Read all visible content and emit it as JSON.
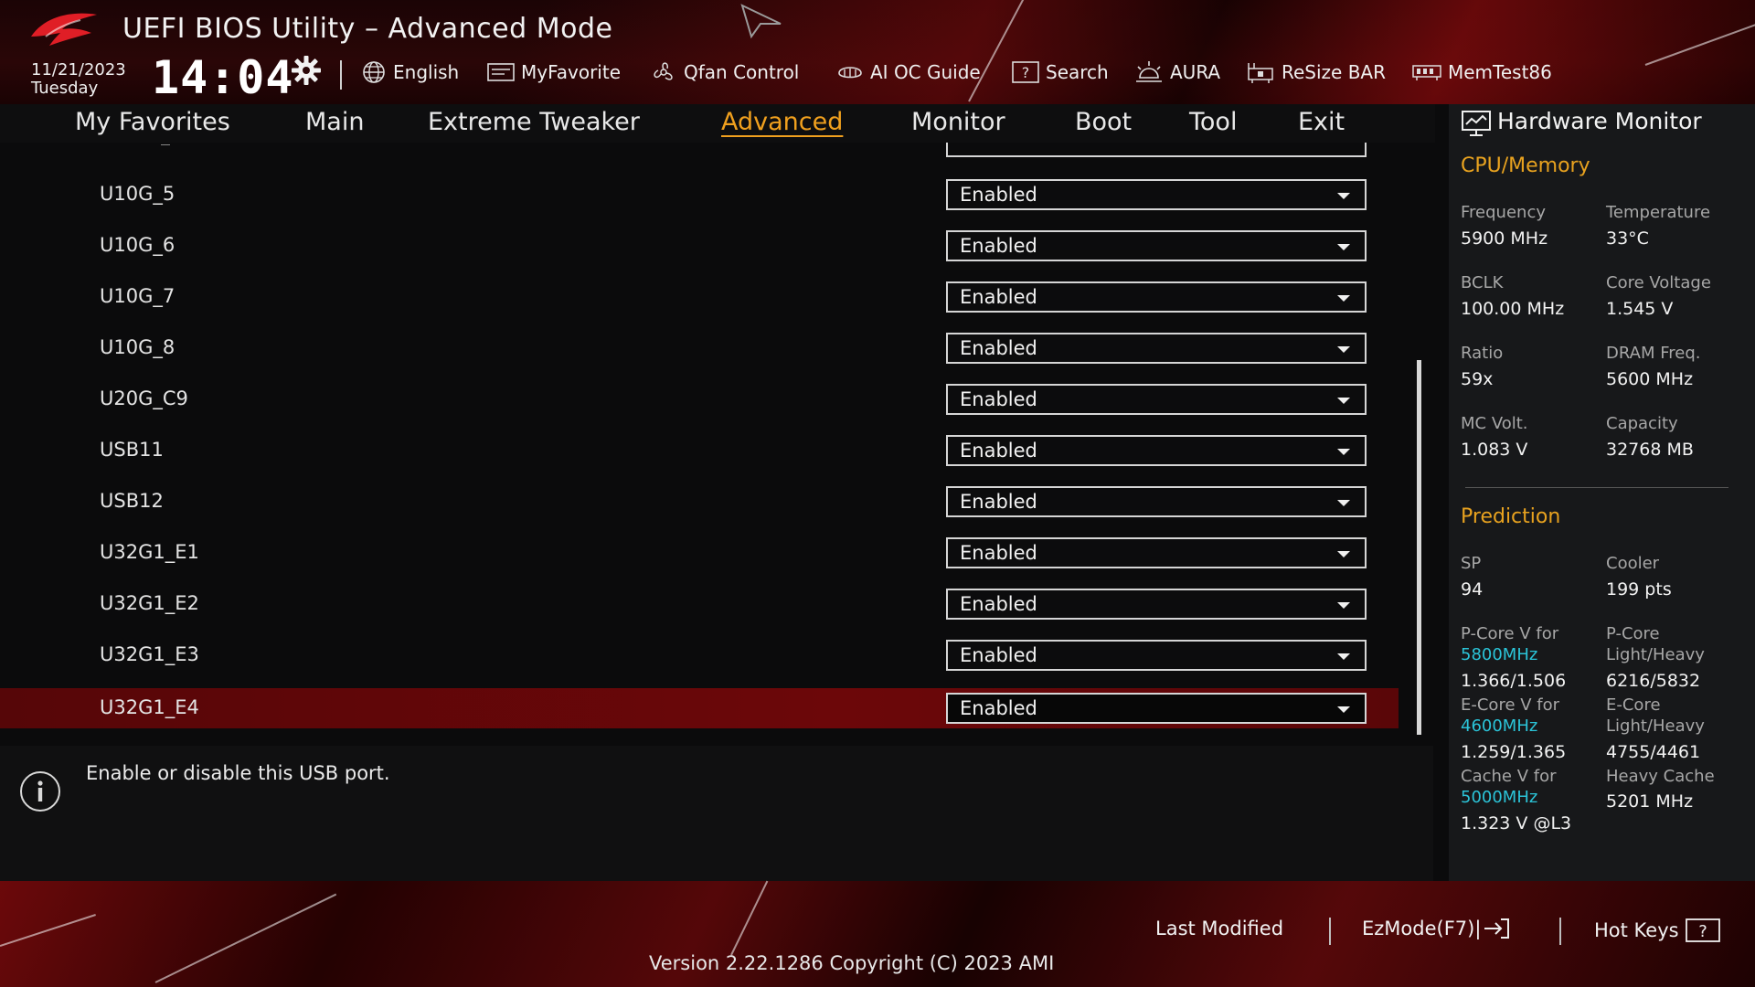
{
  "header": {
    "title": "UEFI BIOS Utility – Advanced Mode",
    "date": "11/21/2023",
    "day": "Tuesday",
    "time": "14:04",
    "tools": [
      {
        "label": "English",
        "icon": "globe-icon"
      },
      {
        "label": "MyFavorite",
        "icon": "favorite-icon"
      },
      {
        "label": "Qfan Control",
        "icon": "fan-icon"
      },
      {
        "label": "AI OC Guide",
        "icon": "ai-oc-icon"
      },
      {
        "label": "Search",
        "icon": "search-icon"
      },
      {
        "label": "AURA",
        "icon": "aura-icon"
      },
      {
        "label": "ReSize BAR",
        "icon": "resize-bar-icon"
      },
      {
        "label": "MemTest86",
        "icon": "memtest-icon"
      }
    ]
  },
  "nav": {
    "items": [
      "My Favorites",
      "Main",
      "Extreme Tweaker",
      "Advanced",
      "Monitor",
      "Boot",
      "Tool",
      "Exit"
    ],
    "active": "Advanced"
  },
  "settings": [
    {
      "label": "U10G_5",
      "value": "Enabled"
    },
    {
      "label": "U10G_6",
      "value": "Enabled"
    },
    {
      "label": "U10G_7",
      "value": "Enabled"
    },
    {
      "label": "U10G_8",
      "value": "Enabled"
    },
    {
      "label": "U20G_C9",
      "value": "Enabled"
    },
    {
      "label": "USB11",
      "value": "Enabled"
    },
    {
      "label": "USB12",
      "value": "Enabled"
    },
    {
      "label": "U32G1_E1",
      "value": "Enabled"
    },
    {
      "label": "U32G1_E2",
      "value": "Enabled"
    },
    {
      "label": "U32G1_E3",
      "value": "Enabled"
    },
    {
      "label": "U32G1_E4",
      "value": "Enabled"
    }
  ],
  "selected_index": 10,
  "info": {
    "text": "Enable or disable this USB port."
  },
  "hardware_monitor": {
    "title": "Hardware Monitor",
    "cpu_memory_title": "CPU/Memory",
    "cpu_memory": [
      {
        "label": "Frequency",
        "value": "5900 MHz"
      },
      {
        "label": "Temperature",
        "value": "33°C"
      },
      {
        "label": "BCLK",
        "value": "100.00 MHz"
      },
      {
        "label": "Core Voltage",
        "value": "1.545 V"
      },
      {
        "label": "Ratio",
        "value": "59x"
      },
      {
        "label": "DRAM Freq.",
        "value": "5600 MHz"
      },
      {
        "label": "MC Volt.",
        "value": "1.083 V"
      },
      {
        "label": "Capacity",
        "value": "32768 MB"
      }
    ],
    "prediction_title": "Prediction",
    "sp_label": "SP",
    "sp_value": "94",
    "cooler_label": "Cooler",
    "cooler_value": "199 pts",
    "pcore_v_label": "P-Core V for",
    "pcore_v_freq": "5800MHz",
    "pcore_v_value": "1.366/1.506",
    "pcore_lh_label1": "P-Core",
    "pcore_lh_label2": "Light/Heavy",
    "pcore_lh_value": "6216/5832",
    "ecore_v_label": "E-Core V for",
    "ecore_v_freq": "4600MHz",
    "ecore_v_value": "1.259/1.365",
    "ecore_lh_label1": "E-Core",
    "ecore_lh_label2": "Light/Heavy",
    "ecore_lh_value": "4755/4461",
    "cache_v_label": "Cache V for",
    "cache_v_freq": "5000MHz",
    "cache_v_value": "1.323 V @L3",
    "heavy_cache_label": "Heavy Cache",
    "heavy_cache_value": "5201 MHz"
  },
  "footer": {
    "last_modified": "Last Modified",
    "ezmode": "EzMode(F7)|",
    "hot_keys": "Hot Keys",
    "version": "Version 2.22.1286 Copyright (C) 2023 AMI"
  },
  "colors": {
    "accent": "#f0a01e",
    "selected_row": "#6c0709",
    "cyan": "#2bc4d8"
  }
}
